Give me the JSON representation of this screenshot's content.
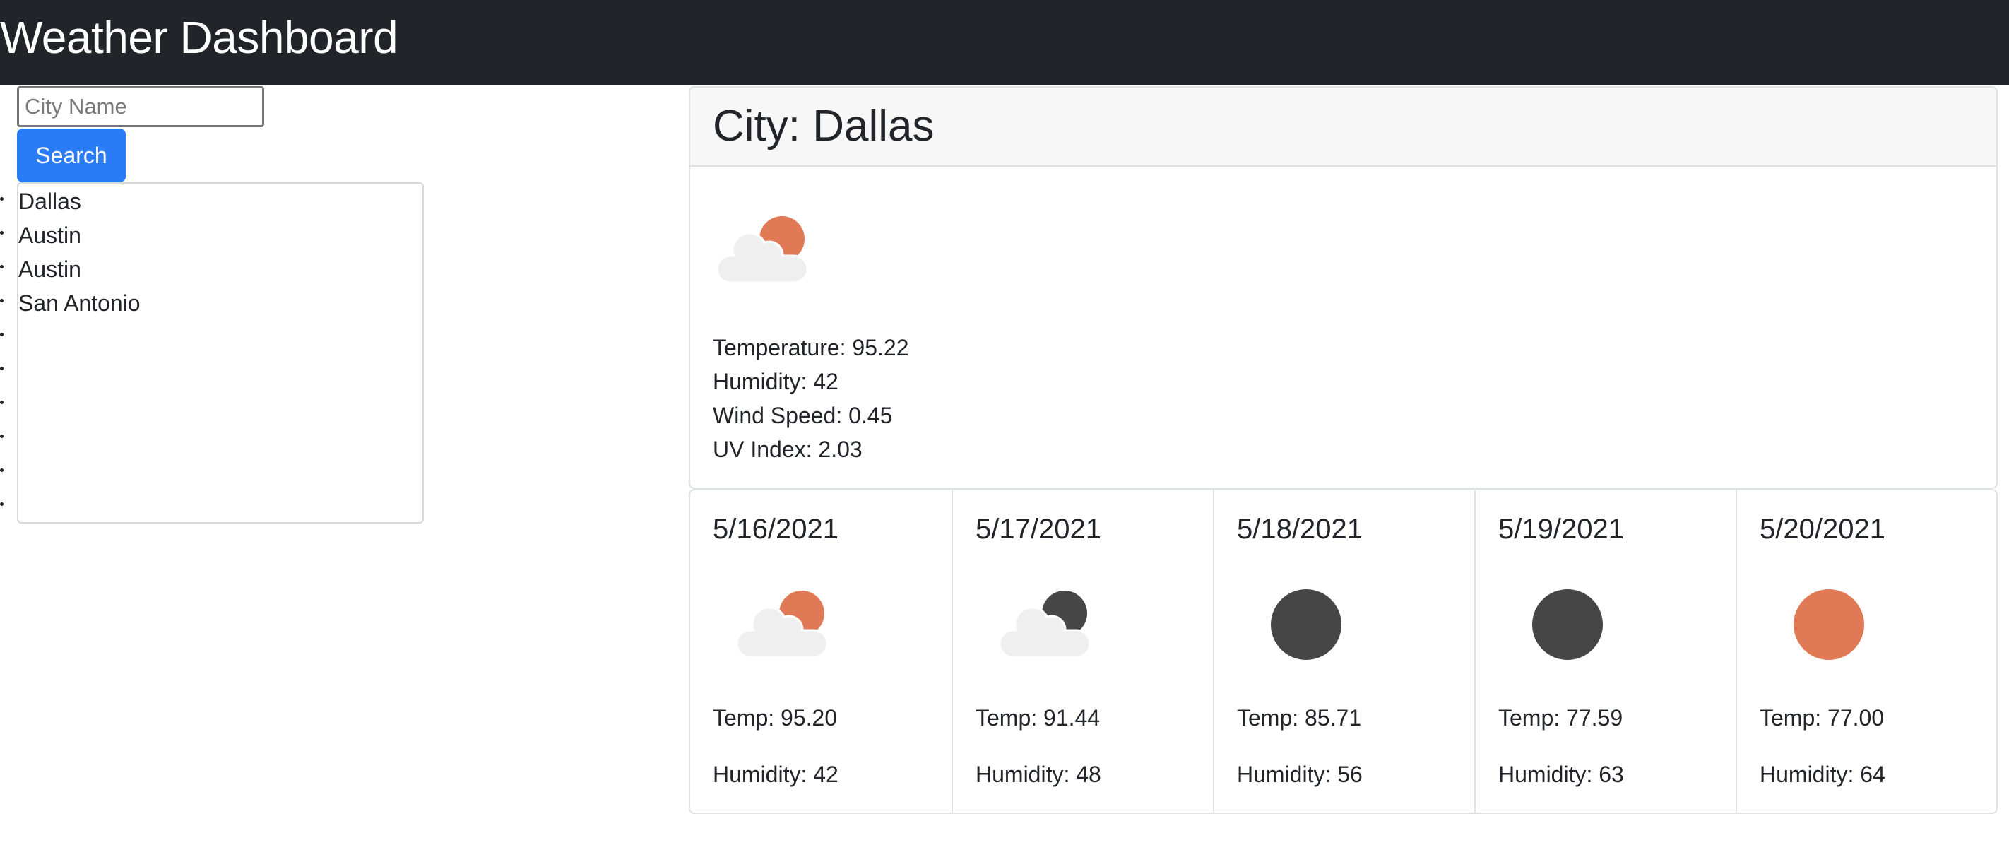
{
  "header": {
    "title": "Weather Dashboard"
  },
  "search": {
    "placeholder": "City Name",
    "value": "",
    "button_label": "Search"
  },
  "history": {
    "items": [
      "Dallas",
      "Austin",
      "Austin",
      "San Antonio"
    ],
    "bullet_count": 10
  },
  "current": {
    "city_title": "City: Dallas",
    "icon": "partly-cloudy-day-icon",
    "temperature": "Temperature: 95.22",
    "humidity": "Humidity: 42",
    "wind_speed": "Wind Speed: 0.45",
    "uv_index": "UV Index: 2.03"
  },
  "forecast": [
    {
      "date": "5/16/2021",
      "icon": "partly-cloudy-day-icon",
      "temp": "Temp: 95.20",
      "humidity": "Humidity: 42"
    },
    {
      "date": "5/17/2021",
      "icon": "partly-cloudy-night-icon",
      "temp": "Temp: 91.44",
      "humidity": "Humidity: 48"
    },
    {
      "date": "5/18/2021",
      "icon": "clear-night-icon",
      "temp": "Temp: 85.71",
      "humidity": "Humidity: 56"
    },
    {
      "date": "5/19/2021",
      "icon": "clear-night-icon",
      "temp": "Temp: 77.59",
      "humidity": "Humidity: 63"
    },
    {
      "date": "5/20/2021",
      "icon": "clear-day-icon",
      "temp": "Temp: 77.00",
      "humidity": "Humidity: 64"
    }
  ],
  "colors": {
    "header_bg": "#212529",
    "button_bg": "#2a7bf6",
    "sun": "#e07a56",
    "moon": "#464646",
    "cloud": "#efefef",
    "border": "#dfe1e3"
  }
}
